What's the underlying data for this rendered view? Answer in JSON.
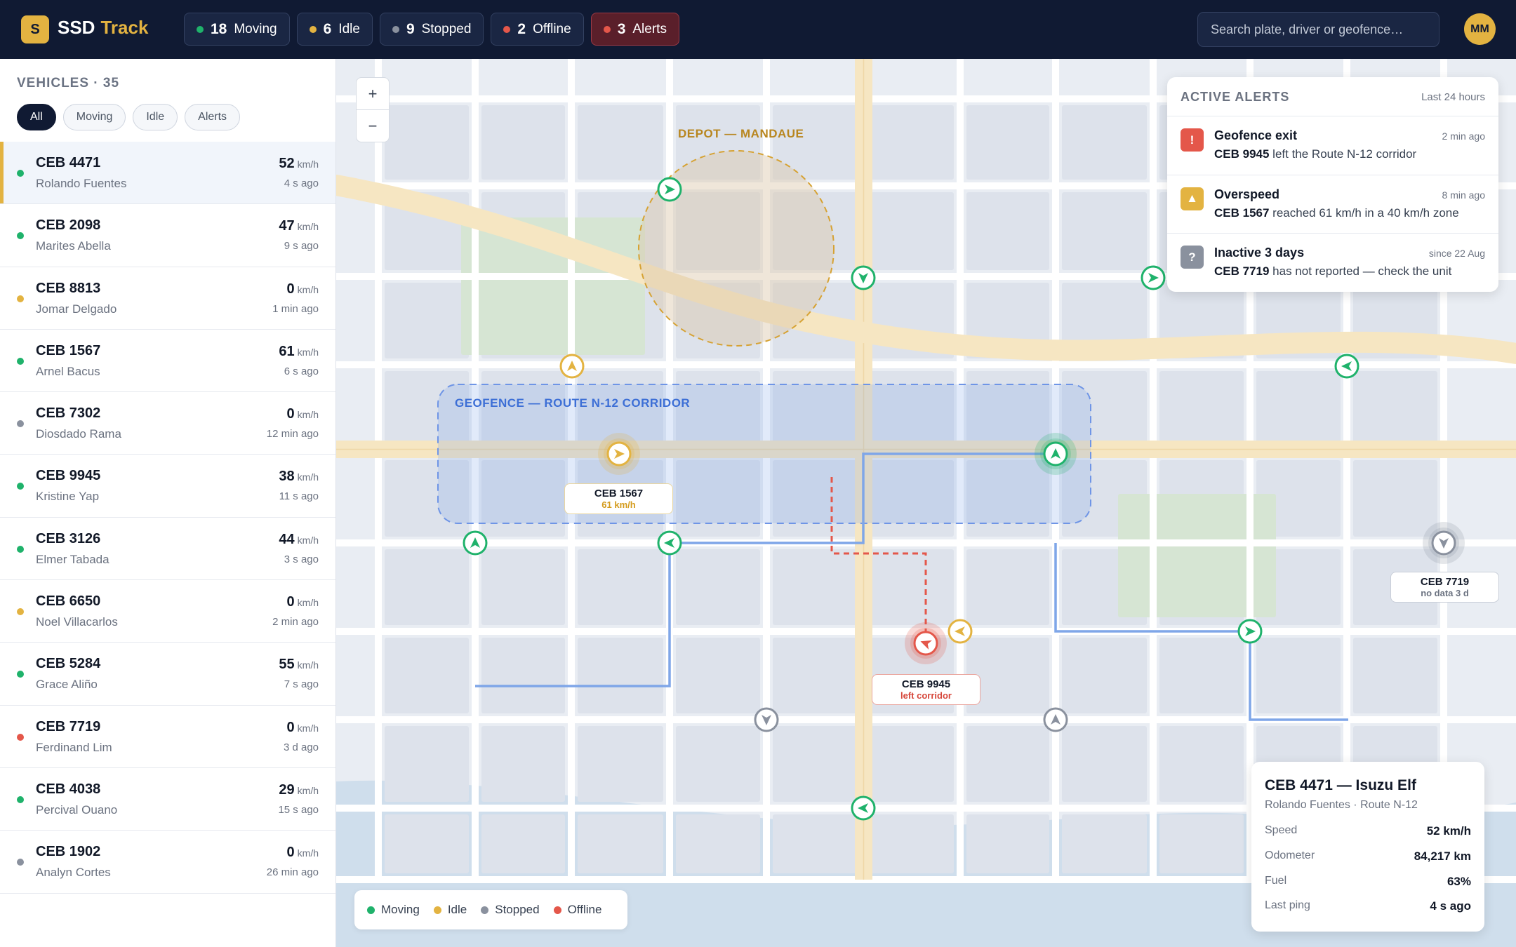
{
  "app": {
    "logo_letter": "S",
    "brand": "SSD",
    "brand_accent": "Track",
    "avatar_initials": "MM"
  },
  "colors": {
    "moving": "#1fb26b",
    "idle": "#e3b341",
    "stopped": "#8a919e",
    "offline": "#e4574a",
    "route": "#7fa6e8",
    "navy": "#101a33"
  },
  "status_chips": [
    {
      "count": "18",
      "label": "Moving",
      "status": "moving"
    },
    {
      "count": "6",
      "label": "Idle",
      "status": "idle"
    },
    {
      "count": "9",
      "label": "Stopped",
      "status": "stopped"
    },
    {
      "count": "2",
      "label": "Offline",
      "status": "offline"
    },
    {
      "count": "3",
      "label": "Alerts",
      "status": "alert"
    }
  ],
  "search": {
    "placeholder": "Search plate, driver or geofence…"
  },
  "sidebar": {
    "title": "VEHICLES · 35",
    "filters": [
      "All",
      "Moving",
      "Idle",
      "Alerts"
    ],
    "active_filter": "All",
    "unit": "km/h",
    "vehicles": [
      {
        "plate": "CEB 4471",
        "driver": "Rolando Fuentes",
        "speed": "52",
        "ago": "4 s ago",
        "status": "moving",
        "selected": true
      },
      {
        "plate": "CEB 2098",
        "driver": "Marites Abella",
        "speed": "47",
        "ago": "9 s ago",
        "status": "moving"
      },
      {
        "plate": "CEB 8813",
        "driver": "Jomar Delgado",
        "speed": "0",
        "ago": "1 min ago",
        "status": "idle"
      },
      {
        "plate": "CEB 1567",
        "driver": "Arnel Bacus",
        "speed": "61",
        "ago": "6 s ago",
        "status": "moving"
      },
      {
        "plate": "CEB 7302",
        "driver": "Diosdado Rama",
        "speed": "0",
        "ago": "12 min ago",
        "status": "stopped"
      },
      {
        "plate": "CEB 9945",
        "driver": "Kristine Yap",
        "speed": "38",
        "ago": "11 s ago",
        "status": "moving"
      },
      {
        "plate": "CEB 3126",
        "driver": "Elmer Tabada",
        "speed": "44",
        "ago": "3 s ago",
        "status": "moving"
      },
      {
        "plate": "CEB 6650",
        "driver": "Noel Villacarlos",
        "speed": "0",
        "ago": "2 min ago",
        "status": "idle"
      },
      {
        "plate": "CEB 5284",
        "driver": "Grace Aliño",
        "speed": "55",
        "ago": "7 s ago",
        "status": "moving"
      },
      {
        "plate": "CEB 7719",
        "driver": "Ferdinand Lim",
        "speed": "0",
        "ago": "3 d ago",
        "status": "offline"
      },
      {
        "plate": "CEB 4038",
        "driver": "Percival Ouano",
        "speed": "29",
        "ago": "15 s ago",
        "status": "moving"
      },
      {
        "plate": "CEB 1902",
        "driver": "Analyn Cortes",
        "speed": "0",
        "ago": "26 min ago",
        "status": "stopped"
      }
    ]
  },
  "map": {
    "zoom_in": "+",
    "zoom_out": "−",
    "depot_label": "DEPOT — MANDAUE",
    "geofence_label": "GEOFENCE — ROUTE N-12 CORRIDOR",
    "labels": {
      "v1567": {
        "plate": "CEB 1567",
        "sub": "61 km/h"
      },
      "v9945": {
        "plate": "CEB 9945",
        "sub": "left corridor"
      },
      "v7719": {
        "plate": "CEB 7719",
        "sub": "no data 3 d"
      }
    },
    "legend": [
      "Moving",
      "Idle",
      "Stopped",
      "Offline"
    ]
  },
  "alerts": {
    "title": "ACTIVE ALERTS",
    "range": "Last 24 hours",
    "items": [
      {
        "icon": "!",
        "icon_name": "alert-icon",
        "color": "#e4574a",
        "title": "Geofence exit",
        "time": "2 min ago",
        "plate": "CEB 9945",
        "text": "left the Route N-12 corridor"
      },
      {
        "icon": "▲",
        "icon_name": "warning-icon",
        "color": "#e3b341",
        "title": "Overspeed",
        "time": "8 min ago",
        "plate": "CEB 1567",
        "text": "reached 61 km/h in a 40 km/h zone"
      },
      {
        "icon": "?",
        "icon_name": "question-icon",
        "color": "#8a919e",
        "title": "Inactive 3 days",
        "time": "since 22 Aug",
        "plate": "CEB 7719",
        "text": "has not reported — check the unit"
      }
    ]
  },
  "detail": {
    "title": "CEB 4471 — Isuzu Elf",
    "subtitle": "Rolando Fuentes · Route N-12",
    "fields": [
      {
        "label": "Speed",
        "value": "52 km/h"
      },
      {
        "label": "Odometer",
        "value": "84,217 km"
      },
      {
        "label": "Fuel",
        "value": "63%"
      },
      {
        "label": "Last ping",
        "value": "4 s ago"
      }
    ]
  }
}
